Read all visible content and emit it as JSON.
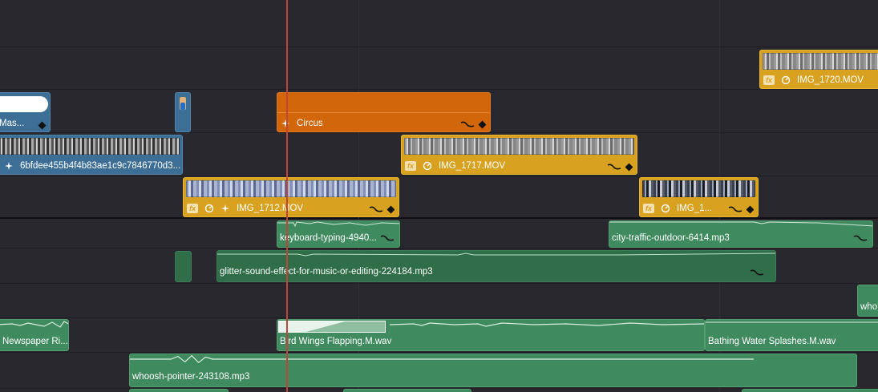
{
  "timeline": {
    "video_clips": [
      {
        "name": "Mas...",
        "color": "#3d6e96"
      },
      {
        "name": "Circus",
        "color": "#d1660a",
        "effect": "sparkle-icon"
      },
      {
        "name": "6bfdee455b4f4b83ae1c9c7846770d3...",
        "color": "#3d6e96",
        "effect": "sparkle-icon"
      },
      {
        "name": "IMG_1717.MOV",
        "color": "#d8a11f",
        "fx": "fx"
      },
      {
        "name": "IMG_1712.MOV",
        "color": "#d8a11f",
        "fx": "fx"
      },
      {
        "name": "IMG_1...",
        "color": "#d8a11f",
        "fx": "fx"
      },
      {
        "name": "IMG_1720.MOV",
        "color": "#d8a11f",
        "fx": "fx"
      }
    ],
    "audio_clips": [
      {
        "name": "keyboard-typing-4940..."
      },
      {
        "name": "city-traffic-outdoor-6414.mp3"
      },
      {
        "name": "glitter-sound-effect-for-music-or-editing-224184.mp3"
      },
      {
        "name": "who"
      },
      {
        "name": "Newspaper Ri..."
      },
      {
        "name": "Bird Wings Flapping.M.wav"
      },
      {
        "name": "Bathing Water Splashes.M.wav"
      },
      {
        "name": "whoosh-pointer-243108.mp3"
      }
    ],
    "playhead_color": "#c0443a"
  }
}
